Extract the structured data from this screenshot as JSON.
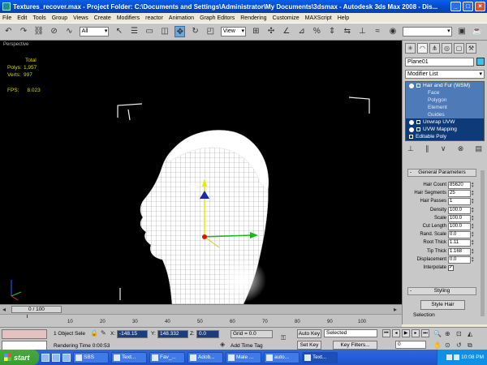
{
  "window": {
    "title": "Textures_recover.max    - Project Folder: C:\\Documents and Settings\\Administrator\\My Documents\\3dsmax    - Autodesk 3ds Max 2008    - Dis..."
  },
  "menu": [
    "File",
    "Edit",
    "Tools",
    "Group",
    "Views",
    "Create",
    "Modifiers",
    "reactor",
    "Animation",
    "Graph Editors",
    "Rendering",
    "Customize",
    "MAXScript",
    "Help"
  ],
  "toolbar": {
    "selection_filter": "All",
    "coord_system": "View"
  },
  "viewport": {
    "label": "Perspective",
    "stats_header": "Total",
    "polys_label": "Polys:",
    "polys_value": "1,957",
    "verts_label": "Verts:",
    "verts_value": "997",
    "fps_label": "FPS:",
    "fps_value": "8.023"
  },
  "command_panel": {
    "object_name": "Plane01",
    "object_color": "#3fc0e6",
    "modifier_list": "Modifier List",
    "stack": [
      {
        "label": "Hair and Fur (WSM)",
        "level": "mod",
        "selected": true
      },
      {
        "label": "Face",
        "level": "sub",
        "selected": true
      },
      {
        "label": "Polygon",
        "level": "sub",
        "selected": true
      },
      {
        "label": "Element",
        "level": "sub",
        "selected": true
      },
      {
        "label": "Guides",
        "level": "sub",
        "selected": true
      },
      {
        "label": "Unwrap UVW",
        "level": "mod",
        "selected": false
      },
      {
        "label": "UVW Mapping",
        "level": "mod",
        "selected": false
      },
      {
        "label": "Editable Poly",
        "level": "mod",
        "selected": false
      }
    ],
    "general_parameters": "General Parameters",
    "params": [
      {
        "label": "Hair Count",
        "value": "85620"
      },
      {
        "label": "Hair Segments",
        "value": "25"
      },
      {
        "label": "Hair Passes",
        "value": "1"
      },
      {
        "label": "Density",
        "value": "100.0"
      },
      {
        "label": "Scale",
        "value": "100.0"
      },
      {
        "label": "Cut Length",
        "value": "100.0"
      },
      {
        "label": "Rand. Scale",
        "value": "0.0"
      },
      {
        "label": "Root Thick",
        "value": "1.11"
      },
      {
        "label": "Tip Thick",
        "value": "1.168"
      },
      {
        "label": "Displacement",
        "value": "0.0"
      }
    ],
    "interpolate_label": "Interpolate",
    "interpolate_checked": "✓",
    "styling": "Styling",
    "style_hair": "Style Hair",
    "selection": "Selection"
  },
  "timeline": {
    "frame": "0 / 100",
    "ticks": [
      "10",
      "20",
      "30",
      "40",
      "50",
      "60",
      "70",
      "80",
      "90",
      "100"
    ]
  },
  "status": {
    "selection_info": "1 Object Sele",
    "x_label": "X:",
    "x_value": "-148.15",
    "y_label": "Y:",
    "y_value": "148.332",
    "z_label": "Z:",
    "z_value": "0.0",
    "grid": "Grid = 0.0",
    "rendering_time": "Rendering Time  0:00:53",
    "add_time_tag": "Add Time Tag",
    "auto_key": "Auto Key",
    "set_key": "Set Key",
    "key_mode": "Selected",
    "key_filters": "Key Filters...",
    "current_frame": "0"
  },
  "taskbar": {
    "start": "start",
    "tasks": [
      "SBS",
      "Text...",
      "Fav_...",
      "Adob...",
      "Male ...",
      "auto...",
      "Text..."
    ],
    "clock": "10:08 PM"
  }
}
